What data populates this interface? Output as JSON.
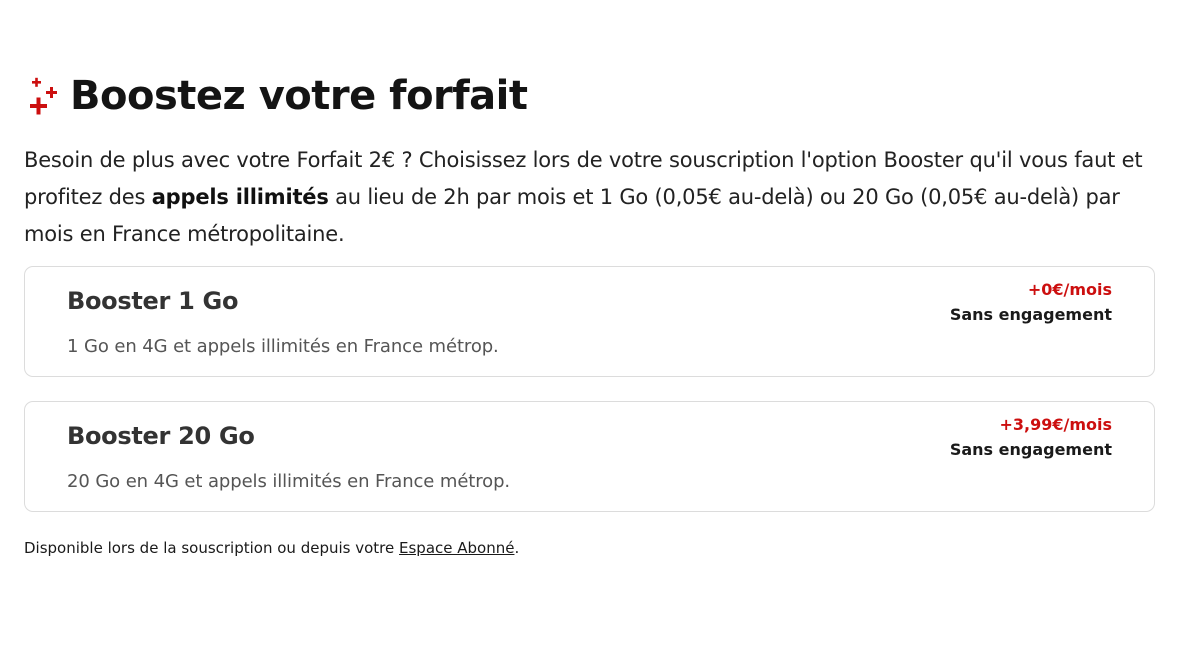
{
  "section": {
    "title": "Boostez votre forfait",
    "title_icon": "sparkle-plus-icon",
    "accent_color": "#cc0f0f",
    "intro_part1": "Besoin de plus avec votre Forfait 2€ ? Choisissez lors de votre souscription l'option Booster qu'il vous faut et profitez des ",
    "intro_bold": "appels illimités",
    "intro_part2": " au lieu de 2h par mois et 1 Go (0,05€ au-delà) ou 20 Go (0,05€ au-delà) par mois en France métropolitaine."
  },
  "options": [
    {
      "name": "Booster 1 Go",
      "description": "1 Go en 4G et appels illimités en France métrop.",
      "price": "+0€/mois",
      "commitment": "Sans engagement"
    },
    {
      "name": "Booster 20 Go",
      "description": "20 Go en 4G et appels illimités en France métrop.",
      "price": "+3,99€/mois",
      "commitment": "Sans engagement"
    }
  ],
  "footer": {
    "text_before": "Disponible lors de la souscription ou depuis votre ",
    "link_label": "Espace Abonné",
    "text_after": "."
  }
}
